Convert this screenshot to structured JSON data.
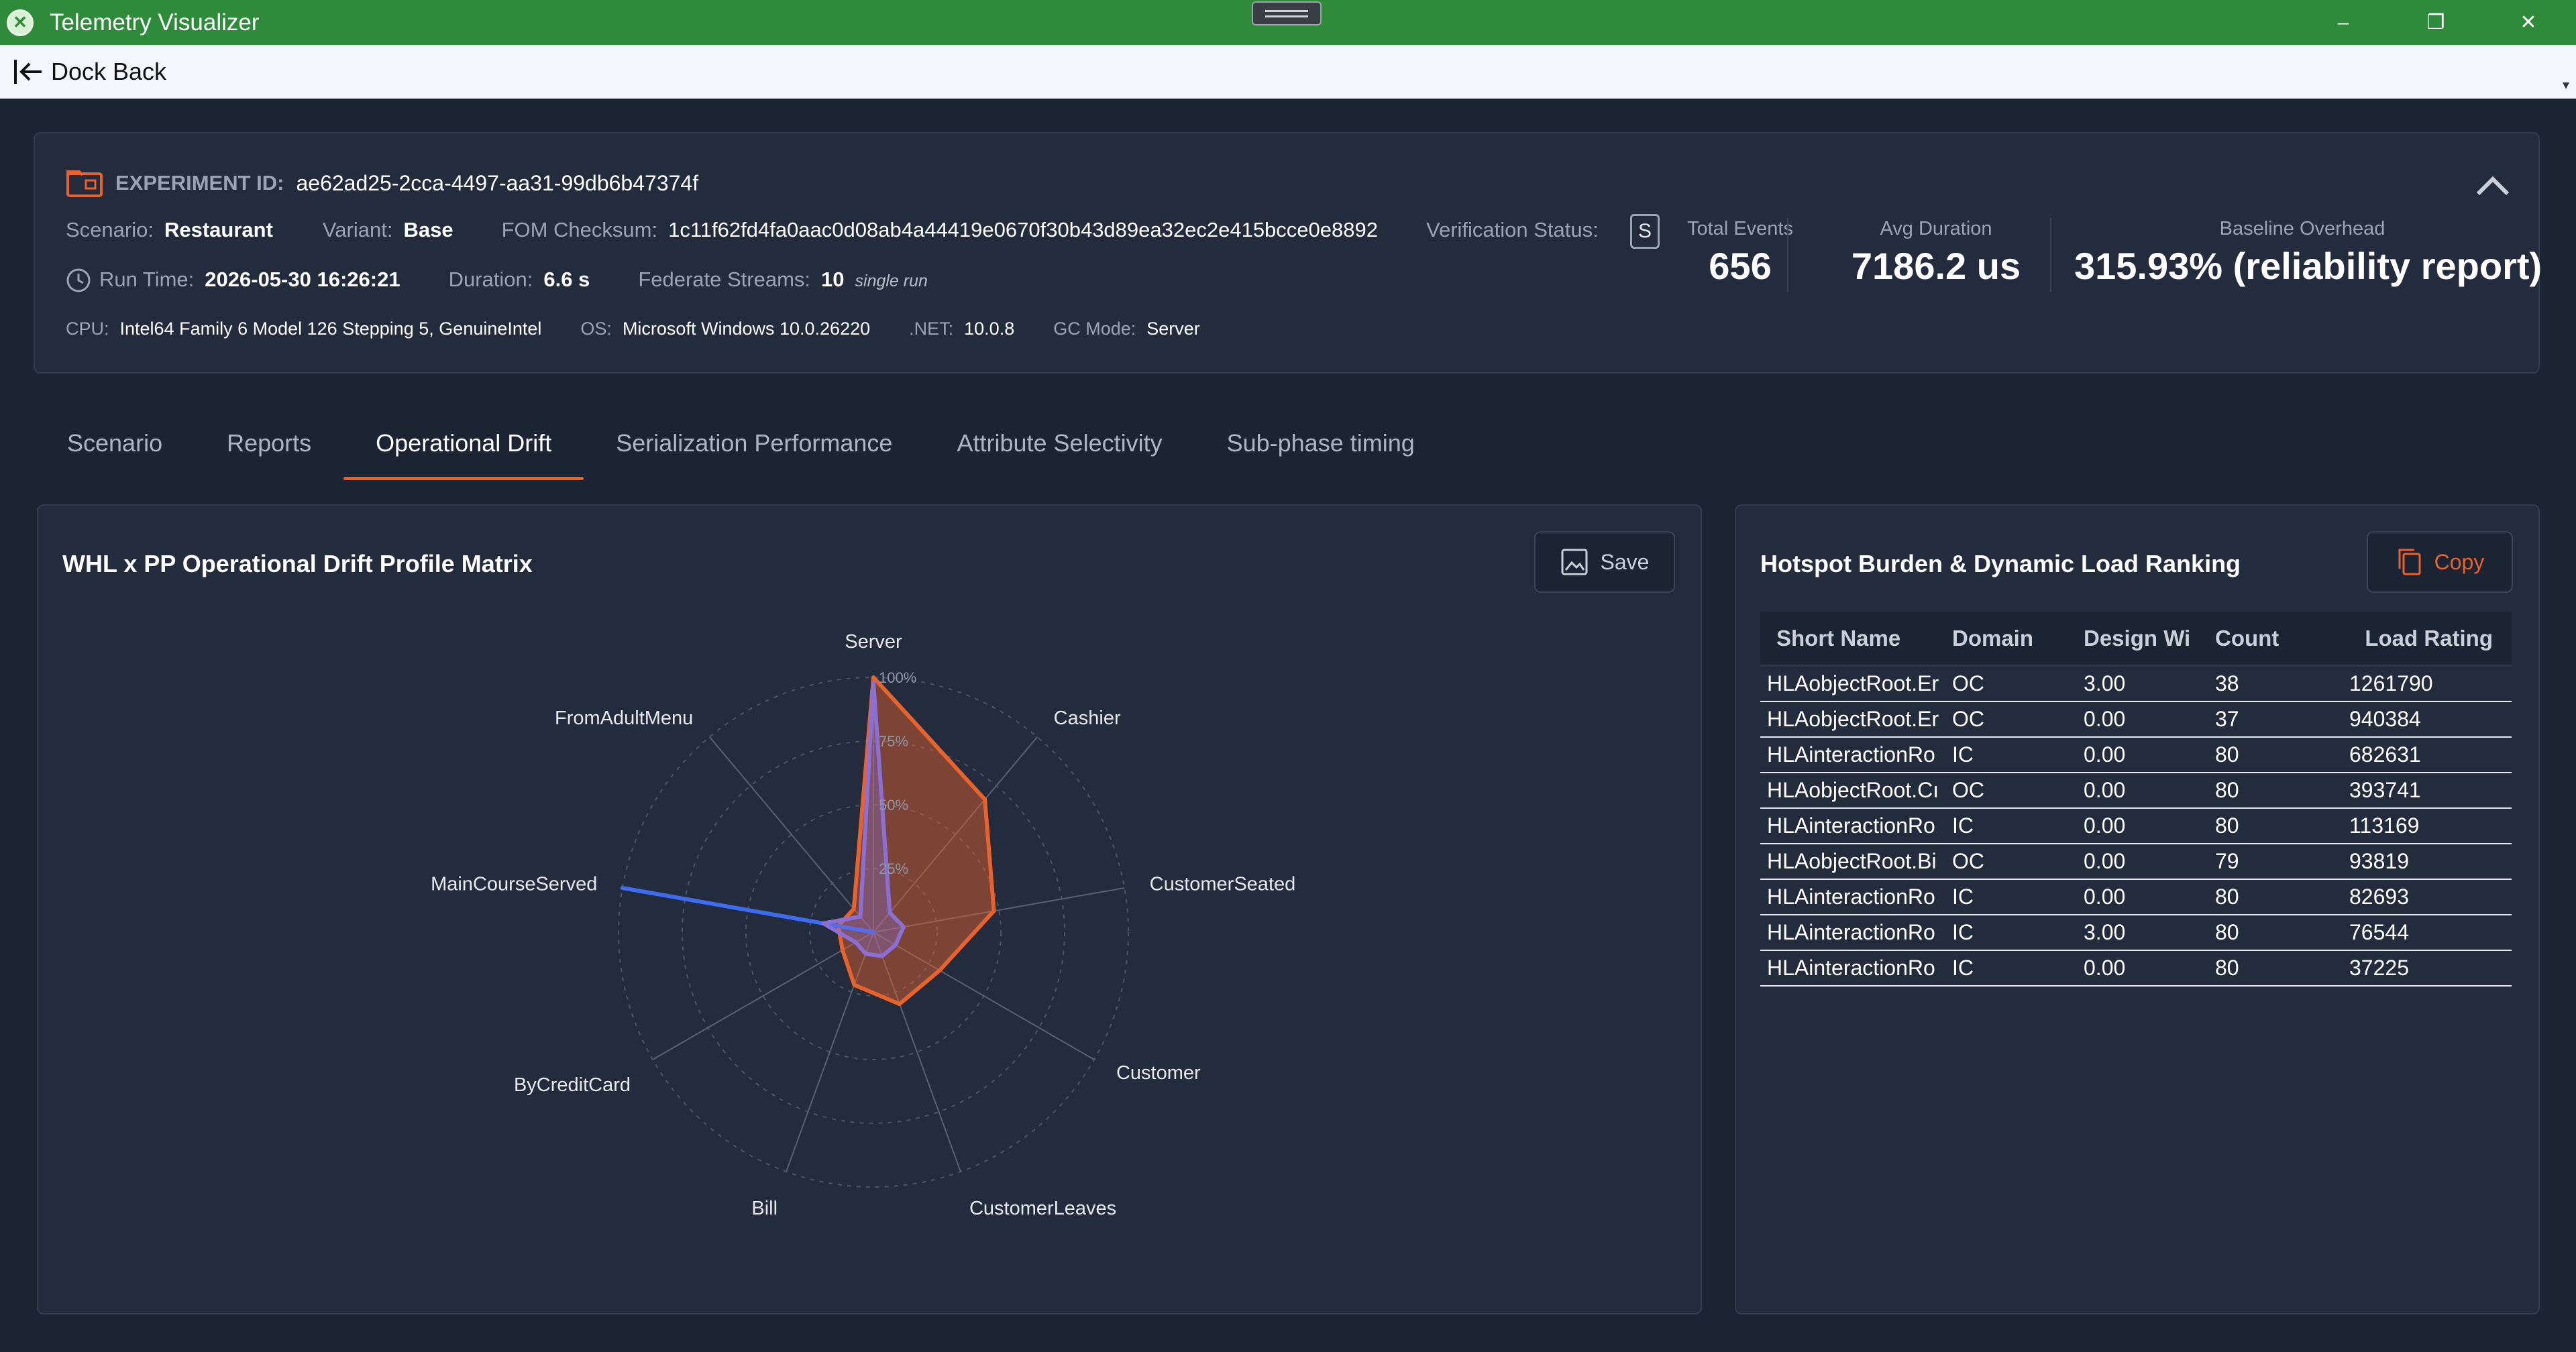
{
  "window": {
    "title": "Telemetry Visualizer",
    "minimize": "–",
    "restore": "❐",
    "close": "✕"
  },
  "dock": {
    "back_label": "Dock Back",
    "overflow": "▾"
  },
  "experiment": {
    "id_label": "EXPERIMENT ID:",
    "id": "ae62ad25-2cca-4497-aa31-99db6b47374f",
    "scenario_label": "Scenario:",
    "scenario": "Restaurant",
    "variant_label": "Variant:",
    "variant": "Base",
    "checksum_label": "FOM Checksum:",
    "checksum": "1c11f62fd4fa0aac0d08ab4a44419e0670f30b43d89ea32ec2e415bcce0e8892",
    "verification_label": "Verification Status:",
    "verification_icon": "S",
    "runtime_label": "Run Time:",
    "runtime": "2026-05-30 16:26:21",
    "duration_label": "Duration:",
    "duration": "6.6 s",
    "streams_label": "Federate Streams:",
    "streams": "10",
    "streams_note": "single run",
    "cpu_label": "CPU:",
    "cpu": "Intel64 Family 6 Model 126 Stepping 5, GenuineIntel",
    "os_label": "OS:",
    "os": "Microsoft Windows 10.0.26220",
    "net_label": ".NET:",
    "net": "10.0.8",
    "gc_label": "GC Mode:",
    "gc": "Server"
  },
  "stats": {
    "total_events_label": "Total Events",
    "total_events": "656",
    "avg_duration_label": "Avg Duration",
    "avg_duration": "7186.2 us",
    "baseline_label": "Baseline Overhead",
    "baseline": "315.93% (reliability report)"
  },
  "tabs": [
    {
      "label": "Scenario"
    },
    {
      "label": "Reports"
    },
    {
      "label": "Operational Drift"
    },
    {
      "label": "Serialization Performance"
    },
    {
      "label": "Attribute Selectivity"
    },
    {
      "label": "Sub-phase timing"
    }
  ],
  "left_panel": {
    "title": "WHL x PP Operational Drift Profile Matrix",
    "save_label": "Save"
  },
  "right_panel": {
    "title": "Hotspot Burden & Dynamic Load Ranking",
    "copy_label": "Copy"
  },
  "colors": {
    "accent": "#e8622a",
    "series_orange": "#e8622a",
    "series_blue": "#3d6cf0",
    "series_purple": "#8a6fd6",
    "titlebar": "#2e8b3a"
  },
  "chart_data": {
    "type": "radar",
    "axes": [
      "Server",
      "Cashier",
      "CustomerSeated",
      "Customer",
      "CustomerLeaves",
      "Bill",
      "ByCreditCard",
      "MainCourseServed",
      "FromAdultMenu"
    ],
    "rings": [
      "25%",
      "50%",
      "75%",
      "100%"
    ],
    "rmax": 100,
    "series": [
      {
        "values": [
          100,
          68,
          48,
          30,
          30,
          22,
          14,
          14,
          12
        ],
        "color": "#e8622a"
      },
      {
        "values": [
          0,
          0,
          0,
          0,
          0,
          0,
          0,
          100,
          0
        ],
        "color": "#3d6cf0"
      },
      {
        "values": [
          98,
          10,
          12,
          10,
          10,
          9,
          8,
          20,
          8
        ],
        "color": "#8a6fd6"
      }
    ]
  },
  "table": {
    "headers": [
      "Short Name",
      "Domain",
      "Design Wi",
      "Count",
      "Load Rating"
    ],
    "rows": [
      [
        "HLAobjectRoot.Er",
        "OC",
        "3.00",
        "38",
        "1261790"
      ],
      [
        "HLAobjectRoot.Er",
        "OC",
        "0.00",
        "37",
        "940384"
      ],
      [
        "HLAinteractionRo",
        "IC",
        "0.00",
        "80",
        "682631"
      ],
      [
        "HLAobjectRoot.Cı",
        "OC",
        "0.00",
        "80",
        "393741"
      ],
      [
        "HLAinteractionRo",
        "IC",
        "0.00",
        "80",
        "113169"
      ],
      [
        "HLAobjectRoot.Bi",
        "OC",
        "0.00",
        "79",
        "93819"
      ],
      [
        "HLAinteractionRo",
        "IC",
        "0.00",
        "80",
        "82693"
      ],
      [
        "HLAinteractionRo",
        "IC",
        "3.00",
        "80",
        "76544"
      ],
      [
        "HLAinteractionRo",
        "IC",
        "0.00",
        "80",
        "37225"
      ]
    ]
  }
}
